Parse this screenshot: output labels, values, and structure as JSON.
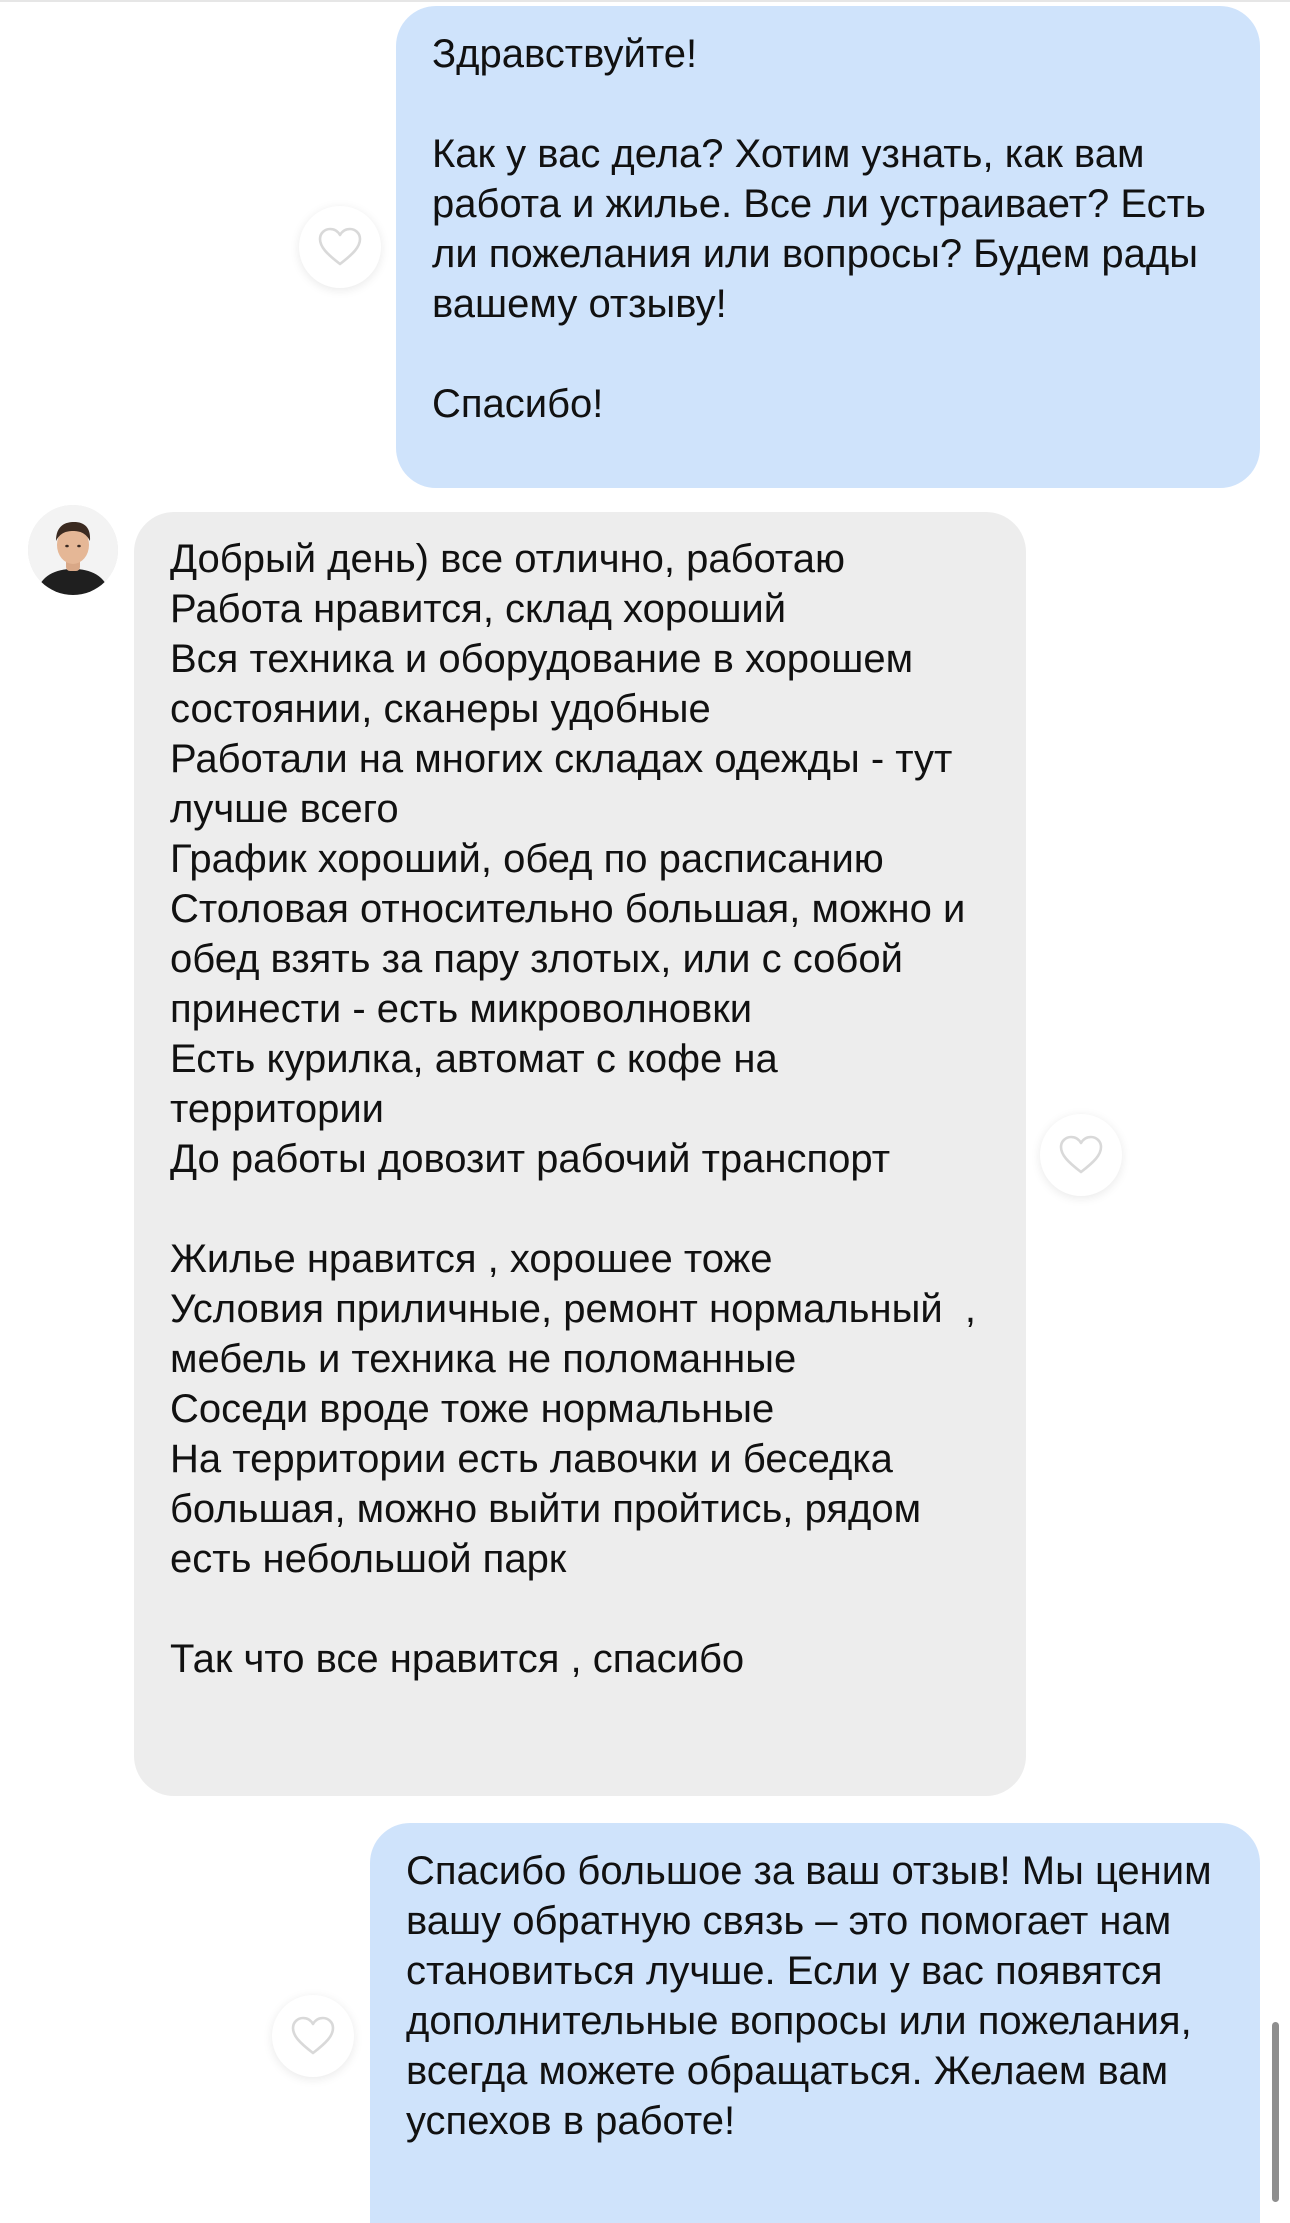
{
  "messages": [
    {
      "direction": "outgoing",
      "text": "Здравствуйте!\n\nКак у вас дела? Хотим узнать, как вам работа и жилье. Все ли устраивает? Есть ли пожелания или вопросы? Будем рады вашему отзыву!\n\nСпасибо!"
    },
    {
      "direction": "incoming",
      "text": "Добрый день) все отлично, работаю\nРабота нравится, склад хороший\nВся техника и оборудование в хорошем состоянии, сканеры удобные\nРаботали на многих складах одежды - тут лучше всего\nГрафик хороший, обед по расписанию\nСтоловая относительно большая, можно и обед взять за пару злотых, или с собой принести - есть микроволновки\nЕсть курилка, автомат с кофе на территории\nДо работы довозит рабочий транспорт\n\nЖилье нравится , хорошее тоже\nУсловия приличные, ремонт нормальный  , мебель и техника не поломанные\nСоседи вроде тоже нормальные\nНа территории есть лавочки и беседка большая, можно выйти пройтись, рядом есть небольшой парк\n\nТак что все нравится , спасибо"
    },
    {
      "direction": "outgoing",
      "text": "Спасибо большое за ваш отзыв! Мы ценим вашу обратную связь – это помогает нам становиться лучше. Если у вас появятся дополнительные вопросы или пожелания, всегда можете обращаться. Желаем вам успехов в работе!"
    }
  ],
  "icons": {
    "like": "heart-outline-icon",
    "avatar": "user-avatar"
  },
  "colors": {
    "outgoing_bubble": "#cfe3fb",
    "incoming_bubble": "#ededed",
    "like_stroke": "#d9d9d9"
  }
}
